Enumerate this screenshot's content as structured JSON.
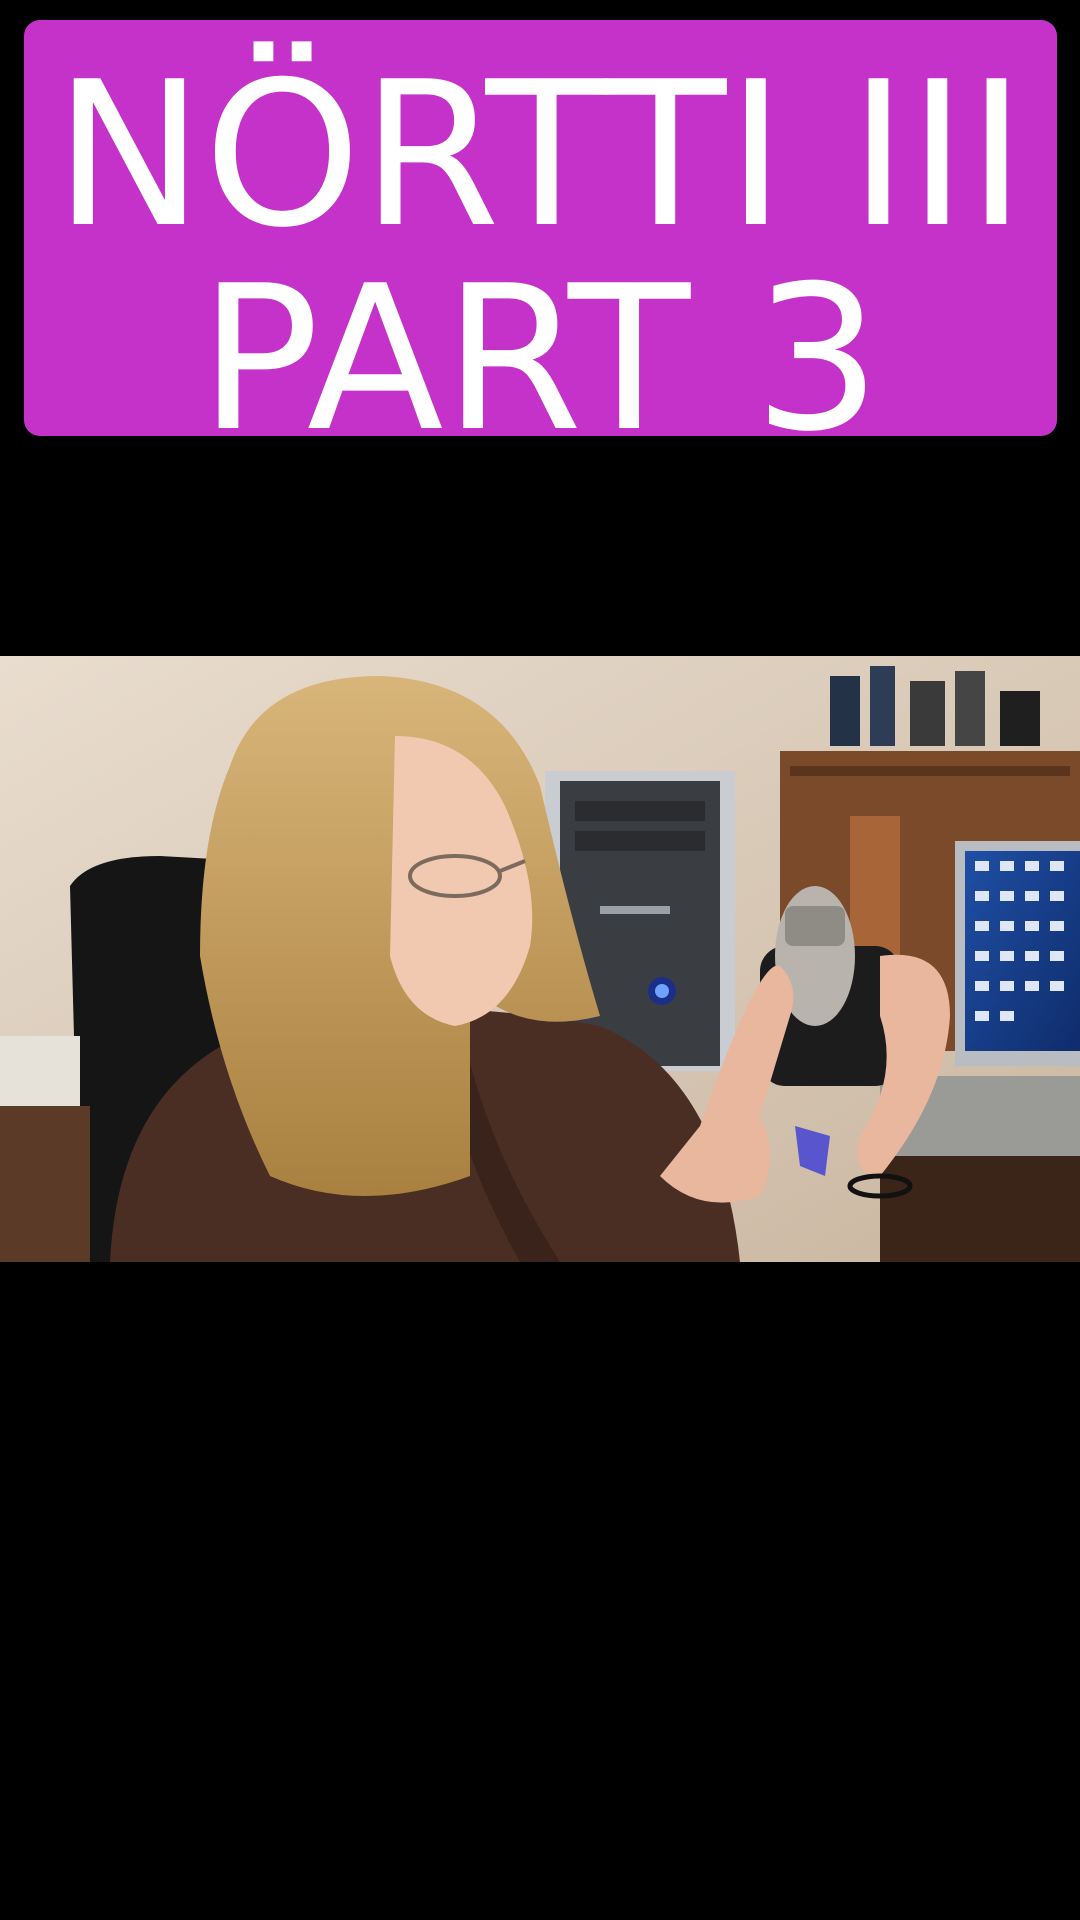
{
  "title": {
    "line1": "NÖRTTI III",
    "line2": "PART 3"
  },
  "colors": {
    "background": "#000000",
    "banner": "#c532c9",
    "banner_text": "#ffffff"
  },
  "video": {
    "description_icon": "video-still-image"
  }
}
